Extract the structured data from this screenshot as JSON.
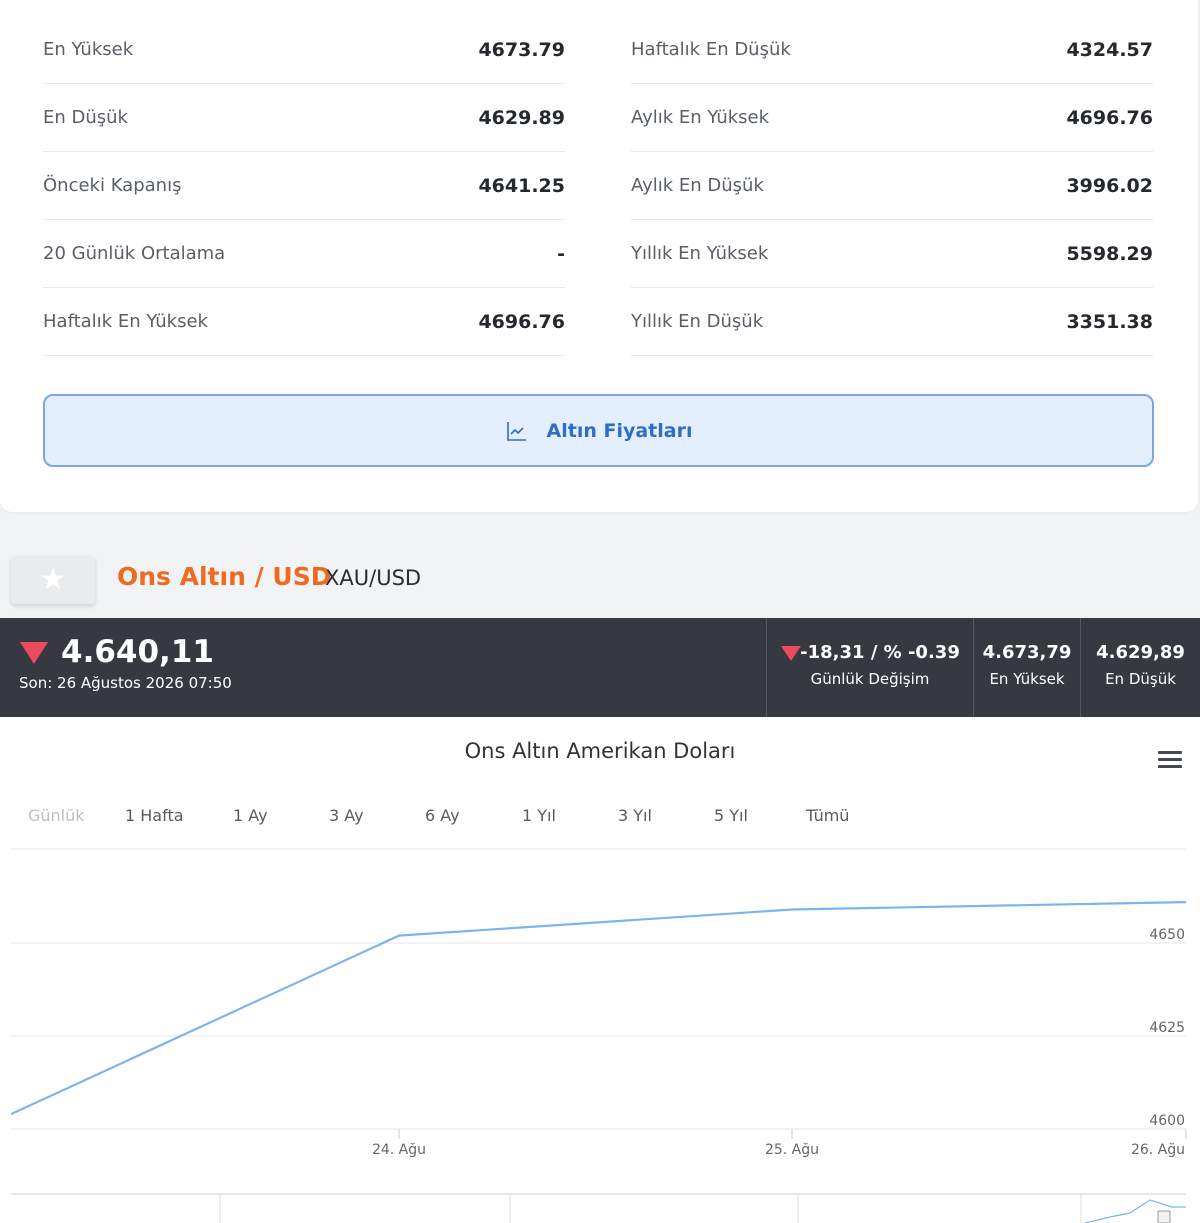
{
  "stats": {
    "left": [
      {
        "label": "En Yüksek",
        "value": "4673.79"
      },
      {
        "label": "En Düşük",
        "value": "4629.89"
      },
      {
        "label": "Önceki Kapanış",
        "value": "4641.25"
      },
      {
        "label": "20 Günlük Ortalama",
        "value": "-"
      },
      {
        "label": "Haftalık En Yüksek",
        "value": "4696.76"
      }
    ],
    "right": [
      {
        "label": "Haftalık En Düşük",
        "value": "4324.57"
      },
      {
        "label": "Aylık En Yüksek",
        "value": "4696.76"
      },
      {
        "label": "Aylık En Düşük",
        "value": "3996.02"
      },
      {
        "label": "Yıllık En Yüksek",
        "value": "5598.29"
      },
      {
        "label": "Yıllık En Düşük",
        "value": "3351.38"
      }
    ]
  },
  "prices_button": {
    "label": "Altın Fiyatları",
    "icon": "line-chart-icon"
  },
  "asset": {
    "name": "Ons Altın / USD",
    "code": "XAU/USD",
    "favorite_icon": "star-icon"
  },
  "quote": {
    "price": "4.640,11",
    "time": "Son: 26 Ağustos 2026 07:50",
    "change": "-18,31 / % -0.39",
    "change_label": "Günlük Değişim",
    "high": "4.673,79",
    "high_label": "En Yüksek",
    "low": "4.629,89",
    "low_label": "En Düşük",
    "direction": "down",
    "down_color": "#ec4b5f"
  },
  "chart": {
    "title": "Ons Altın Amerikan Doları",
    "menu_icon": "hamburger-menu-icon",
    "ranges": [
      "Günlük",
      "1 Hafta",
      "1 Ay",
      "3 Ay",
      "6 Ay",
      "1 Yıl",
      "3 Yıl",
      "5 Yıl",
      "Tümü"
    ],
    "line_color": "#7cb5ec"
  },
  "chart_data": {
    "type": "line",
    "title": "Ons Altın Amerikan Doları",
    "xlabel": "",
    "ylabel": "",
    "x_ticks": [
      "24. Ağu",
      "25. Ağu",
      "26. Ağu"
    ],
    "y_ticks": [
      4600,
      4625,
      4650
    ],
    "ylim": [
      4600,
      4675
    ],
    "grid": true,
    "series": [
      {
        "x": [
          "23. Ağu",
          "24. Ağu",
          "25. Ağu",
          "26. Ağu"
        ],
        "values": [
          4604,
          4652,
          4659,
          4661
        ]
      }
    ]
  }
}
